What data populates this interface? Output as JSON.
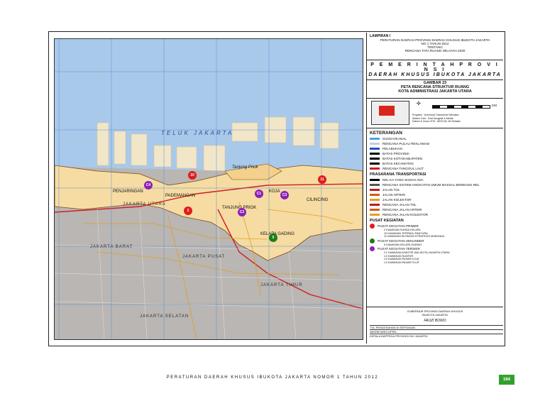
{
  "header": {
    "lampiran": "LAMPIRAN I",
    "line1": "PERATURAN DAERAH PROVINSI DAERAH KHUSUS IBUKOTA JAKARTA",
    "line2": "NO 1 TAHUN 2012",
    "line3": "TENTANG",
    "line4": "RENCANA TATA RUANG WILAYAH 2030"
  },
  "government": {
    "line1": "P E M E R I N T A H   P R O V I N S I",
    "line2": "DAERAH KHUSUS IBUKOTA JAKARTA"
  },
  "figure": {
    "number": "GAMBAR 23",
    "title1": "PETA RENCANA STRUKTUR RUANG",
    "title2": "KOTA ADMINISTRASI JAKARTA UTARA"
  },
  "inset_info": {
    "proyeksi": "Proyeksi",
    "proyeksi_val": "Universal Transverse Mercator",
    "system_grid": "Sistem Grid",
    "system_grid_val": "Grid Geografi & Metrik",
    "datum": "Datum & Zona UTM",
    "datum_val": "WGS 84, 48 Selatan",
    "scale_unit": "KM"
  },
  "legend": {
    "title": "KETERANGAN",
    "items": [
      {
        "label": "SUNGAI/KANAL",
        "color": "#4aa3e0"
      },
      {
        "label": "RENCANA PULAU REKLAMASI",
        "color": "#cccccc"
      },
      {
        "label": "PELABUHAN",
        "color": "#1e50c8"
      },
      {
        "label": "BATAS PROVINSI",
        "color": "#000000"
      },
      {
        "label": "BATAS KOTA/KABUPATEN",
        "color": "#000000"
      },
      {
        "label": "BATAS KECAMATAN",
        "color": "#000000"
      },
      {
        "label": "RENCANA TANGGUL LAUT",
        "color": "#d11c1c"
      }
    ],
    "transport_title": "PRASARANA TRANSPORTASI",
    "transport": [
      {
        "label": "REL KA YANG SUDAH ADA",
        "color": "#000000"
      },
      {
        "label": "RENCANA SISTEM ANGKUTAN UMUM MASSAL BERBASIS REL",
        "color": "#555555"
      },
      {
        "label": "JALAN TOL",
        "color": "#c31a1a"
      },
      {
        "label": "JALAN ARTERI",
        "color": "#d45b1a"
      },
      {
        "label": "JALAN KOLEKTOR",
        "color": "#e0a020"
      },
      {
        "label": "RENCANA JALAN TOL",
        "color": "#c31a1a"
      },
      {
        "label": "RENCANA JALAN ARTERI",
        "color": "#d45b1a"
      },
      {
        "label": "RENCANA JALAN KOLEKTOR",
        "color": "#e0a020"
      }
    ],
    "activity_title": "PUSAT KEGIATAN",
    "activities": [
      {
        "label": "PUSAT KEGIATAN PRIMER",
        "color": "#e11b1b",
        "subs": [
          "2  KAWASAN SUNDA KELAPA",
          "10 KAWASAN TERPADU PANTURA",
          "11 KAWASAN EKONOMI STRATEGIS MARUNDA"
        ]
      },
      {
        "label": "PUSAT KEGIATAN SEKUNDER",
        "color": "#1d7d1d",
        "subs": [
          "5  KAWASAN KELAPA GADING"
        ]
      },
      {
        "label": "PUSAT KEGIATAN TERSIER",
        "color": "#8b21b8",
        "subs": [
          "C1  KAWASAN KANTOR WALIKOTA JAKARTA UTARA",
          "C2  KAWASAN SUNTER",
          "C3  KAWASAN PASAR KOJA",
          "C4  KAWASAN PASAR PLUIT"
        ]
      }
    ]
  },
  "signature": {
    "line1": "GUBERNUR PROVINSI DAERAH KHUSUS",
    "line2": "IBUKOTA JAKARTA",
    "sign": "FAUZI BOWO",
    "row1": "TGL PENGESAHAN DI SERTAKAN",
    "row2": "SEKRETARIS DPRD",
    "row3": "KEPALA BAPPEDA PROVINSI DKI JAKARTA"
  },
  "map": {
    "sea_label": "TELUK JAKARTA",
    "places": {
      "penjaringan": "PENJARINGAN",
      "pademangan": "PADEMANGAN",
      "tanjung_priok": "TANJUNG PRIOK",
      "tanjung_priok_port": "Tanjung Priok",
      "koja": "KOJA",
      "cilincing": "CILINCING",
      "kelapa_gading": "KELAPA GADING",
      "jakarta_barat": "JAKARTA BARAT",
      "jakarta_pusat": "JAKARTA PUSAT",
      "jakarta_timur": "JAKARTA TIMUR",
      "jakarta_selatan": "JAKARTA SELATAN",
      "jakarta_utara": "JAKARTA UTARA"
    },
    "markers": [
      {
        "id": "10",
        "kind": "primer"
      },
      {
        "id": "11",
        "kind": "primer"
      },
      {
        "id": "2",
        "kind": "primer"
      },
      {
        "id": "C4",
        "kind": "tersier"
      },
      {
        "id": "C1",
        "kind": "tersier"
      },
      {
        "id": "C3",
        "kind": "tersier"
      },
      {
        "id": "C2",
        "kind": "tersier"
      },
      {
        "id": "5",
        "kind": "sekunder"
      }
    ]
  },
  "footer": {
    "text": "PERATURAN DAERAH KHUSUS IBUKOTA JAKARTA NOMOR 1 TAHUN 2012",
    "page": "164"
  }
}
